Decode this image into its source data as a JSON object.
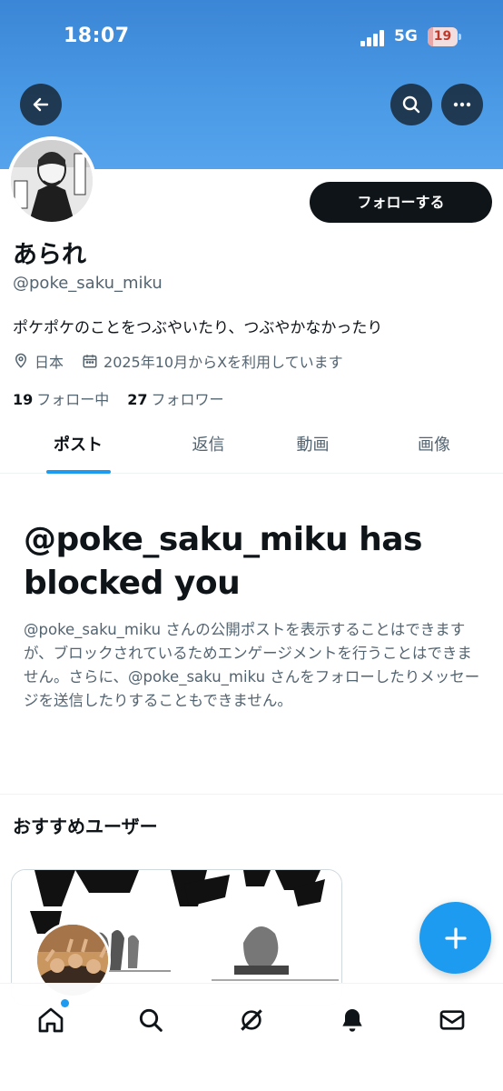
{
  "status_bar": {
    "time": "18:07",
    "network": "5G",
    "battery": "19",
    "battery_level": 0.19
  },
  "header": {
    "back_icon": "arrow-left-icon",
    "search_icon": "search-icon",
    "more_icon": "more-horizontal-icon"
  },
  "profile": {
    "display_name": "あられ",
    "handle": "@poke_saku_miku",
    "bio": "ポケポケのことをつぶやいたり、つぶやかなかったり",
    "location": "日本",
    "joined": "2025年10月からXを利用しています",
    "following_count": "19",
    "following_label": "フォロー中",
    "followers_count": "27",
    "followers_label": "フォロワー",
    "follow_button": "フォローする"
  },
  "tabs": [
    {
      "label": "ポスト",
      "active": true
    },
    {
      "label": "返信",
      "active": false
    },
    {
      "label": "動画",
      "active": false
    },
    {
      "label": "画像",
      "active": false
    }
  ],
  "blocked": {
    "title": "@poke_saku_miku has blocked you",
    "description": "@poke_saku_miku さんの公開ポストを表示することはできますが、ブロックされているためエンゲージメントを行うことはできません。さらに、@poke_saku_miku さんをフォローしたりメッセージを送信したりすることもできません。"
  },
  "recommendations": {
    "heading": "おすすめユーザー"
  },
  "fab": {
    "icon": "plus-icon"
  },
  "bottom_nav": [
    {
      "name": "home-icon",
      "has_dot": true
    },
    {
      "name": "search-icon"
    },
    {
      "name": "grok-icon"
    },
    {
      "name": "notifications-icon"
    },
    {
      "name": "messages-icon"
    }
  ],
  "colors": {
    "accent": "#1d9bf0",
    "banner": "#4a9ae6",
    "text": "#0f1419",
    "muted": "#536471"
  }
}
